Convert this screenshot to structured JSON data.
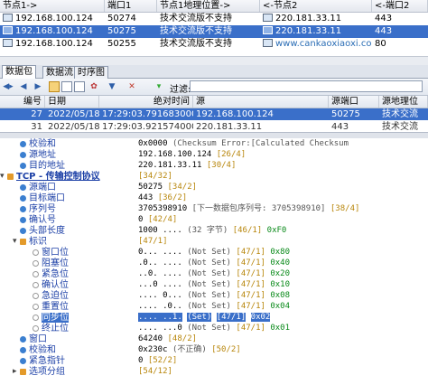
{
  "session_table": {
    "columns": [
      "节点1->",
      "端口1",
      "节点1地理位置->",
      "<-节点2",
      "<-端口2"
    ],
    "rows": [
      {
        "node1": "192.168.100.124",
        "port1": "50274",
        "geo1": "技术交流版不支持",
        "node2": "220.181.33.11",
        "port2": "443",
        "selected": false
      },
      {
        "node1": "192.168.100.124",
        "port1": "50275",
        "geo1": "技术交流版不支持",
        "node2": "220.181.33.11",
        "port2": "443",
        "selected": true
      },
      {
        "node1": "192.168.100.124",
        "port1": "50255",
        "geo1": "技术交流版不支持",
        "node2": "www.cankaoxiaoxi.co...",
        "port2": "80",
        "selected": false
      }
    ]
  },
  "tabs": [
    "数据包",
    "数据流",
    "时序图"
  ],
  "active_tab": 0,
  "toolbar": {
    "filter_label": "过滤:",
    "filter_value": "",
    "icons": [
      "nav-first-icon",
      "nav-prev-icon",
      "nav-next-icon",
      "view-mode-1-icon",
      "view-mode-2-icon",
      "view-mode-3-icon",
      "color-icon",
      "filter-icon",
      "clear-icon"
    ]
  },
  "packet_list": {
    "columns": [
      "编号",
      "日期",
      "绝对时间",
      "源",
      "源端口",
      "源地理位"
    ],
    "rows": [
      {
        "no": "27",
        "date": "2022/05/18",
        "time": "17:29:03.791683000",
        "src": "192.168.100.124",
        "sport": "50275",
        "geo": "技术交流"
      },
      {
        "no": "31",
        "date": "2022/05/18",
        "time": "17:29:03.921574000",
        "src": "220.181.33.11",
        "sport": "443",
        "geo": "技术交流"
      }
    ]
  },
  "tree": [
    {
      "level": 1,
      "icon": "dot",
      "label": "校验和",
      "value": "0x0000",
      "comment": "(Checksum Error:[Calculated Checksum",
      "pos": ""
    },
    {
      "level": 1,
      "icon": "dot",
      "label": "源地址",
      "value": "192.168.100.124",
      "comment": "",
      "pos": "[26/4]"
    },
    {
      "level": 1,
      "icon": "dot",
      "label": "目的地址",
      "value": "220.181.33.11",
      "comment": "",
      "pos": "[30/4]"
    },
    {
      "level": 0,
      "icon": "node",
      "label": "TCP - 传输控制协议",
      "value": "",
      "comment": "",
      "pos": "[34/32]",
      "expanded": true
    },
    {
      "level": 1,
      "icon": "dot",
      "label": "源端口",
      "value": "50275",
      "comment": "",
      "pos": "[34/2]"
    },
    {
      "level": 1,
      "icon": "dot",
      "label": "目标端口",
      "value": "443",
      "comment": "",
      "pos": "[36/2]"
    },
    {
      "level": 1,
      "icon": "dot",
      "label": "序列号",
      "value": "3705398910",
      "comment": "[下一数据包序列号: 3705398910]",
      "pos": "[38/4]"
    },
    {
      "level": 1,
      "icon": "dot",
      "label": "确认号",
      "value": "0",
      "comment": "",
      "pos": "[42/4]"
    },
    {
      "level": 1,
      "icon": "dot",
      "label": "头部长度",
      "value": "1000 ....",
      "comment": "(32 字节)",
      "pos": "[46/1]",
      "extra": "0xF0"
    },
    {
      "level": 1,
      "icon": "node",
      "label": "标识",
      "value": "",
      "comment": "",
      "pos": "[47/1]",
      "expanded": true
    },
    {
      "level": 2,
      "icon": "bit",
      "label": "窗口位",
      "value": "0... ....",
      "comment": "(Not Set)",
      "pos": "[47/1]",
      "extra": "0x80"
    },
    {
      "level": 2,
      "icon": "bit",
      "label": "阻塞位",
      "value": ".0.. ....",
      "comment": "(Not Set)",
      "pos": "[47/1]",
      "extra": "0x40"
    },
    {
      "level": 2,
      "icon": "bit",
      "label": "紧急位",
      "value": "..0. ....",
      "comment": "(Not Set)",
      "pos": "[47/1]",
      "extra": "0x20"
    },
    {
      "level": 2,
      "icon": "bit",
      "label": "确认位",
      "value": "...0 ....",
      "comment": "(Not Set)",
      "pos": "[47/1]",
      "extra": "0x10"
    },
    {
      "level": 2,
      "icon": "bit",
      "label": "急迫位",
      "value": ".... 0...",
      "comment": "(Not Set)",
      "pos": "[47/1]",
      "extra": "0x08"
    },
    {
      "level": 2,
      "icon": "bit",
      "label": "重置位",
      "value": ".... .0..",
      "comment": "(Not Set)",
      "pos": "[47/1]",
      "extra": "0x04"
    },
    {
      "level": 2,
      "icon": "bit",
      "label": "同步位",
      "value": ".... ..1.",
      "comment": "(Set)",
      "pos": "[47/1]",
      "extra": "0x02",
      "selected": true
    },
    {
      "level": 2,
      "icon": "bit",
      "label": "终止位",
      "value": ".... ...0",
      "comment": "(Not Set)",
      "pos": "[47/1]",
      "extra": "0x01"
    },
    {
      "level": 1,
      "icon": "dot",
      "label": "窗口",
      "value": "64240",
      "comment": "",
      "pos": "[48/2]"
    },
    {
      "level": 1,
      "icon": "dot",
      "label": "校验和",
      "value": "0x230c",
      "comment": "(不正确)",
      "pos": "[50/2]"
    },
    {
      "level": 1,
      "icon": "dot",
      "label": "紧急指针",
      "value": "0",
      "comment": "",
      "pos": "[52/2]"
    },
    {
      "level": 1,
      "icon": "node",
      "label": "选项分组",
      "value": "",
      "comment": "",
      "pos": "[54/12]",
      "expanded": false
    }
  ],
  "colors": {
    "selection": "#3a6fc9",
    "label": "#1b3fa6",
    "position": "#b8860b",
    "bits": "#0a8a1a"
  }
}
